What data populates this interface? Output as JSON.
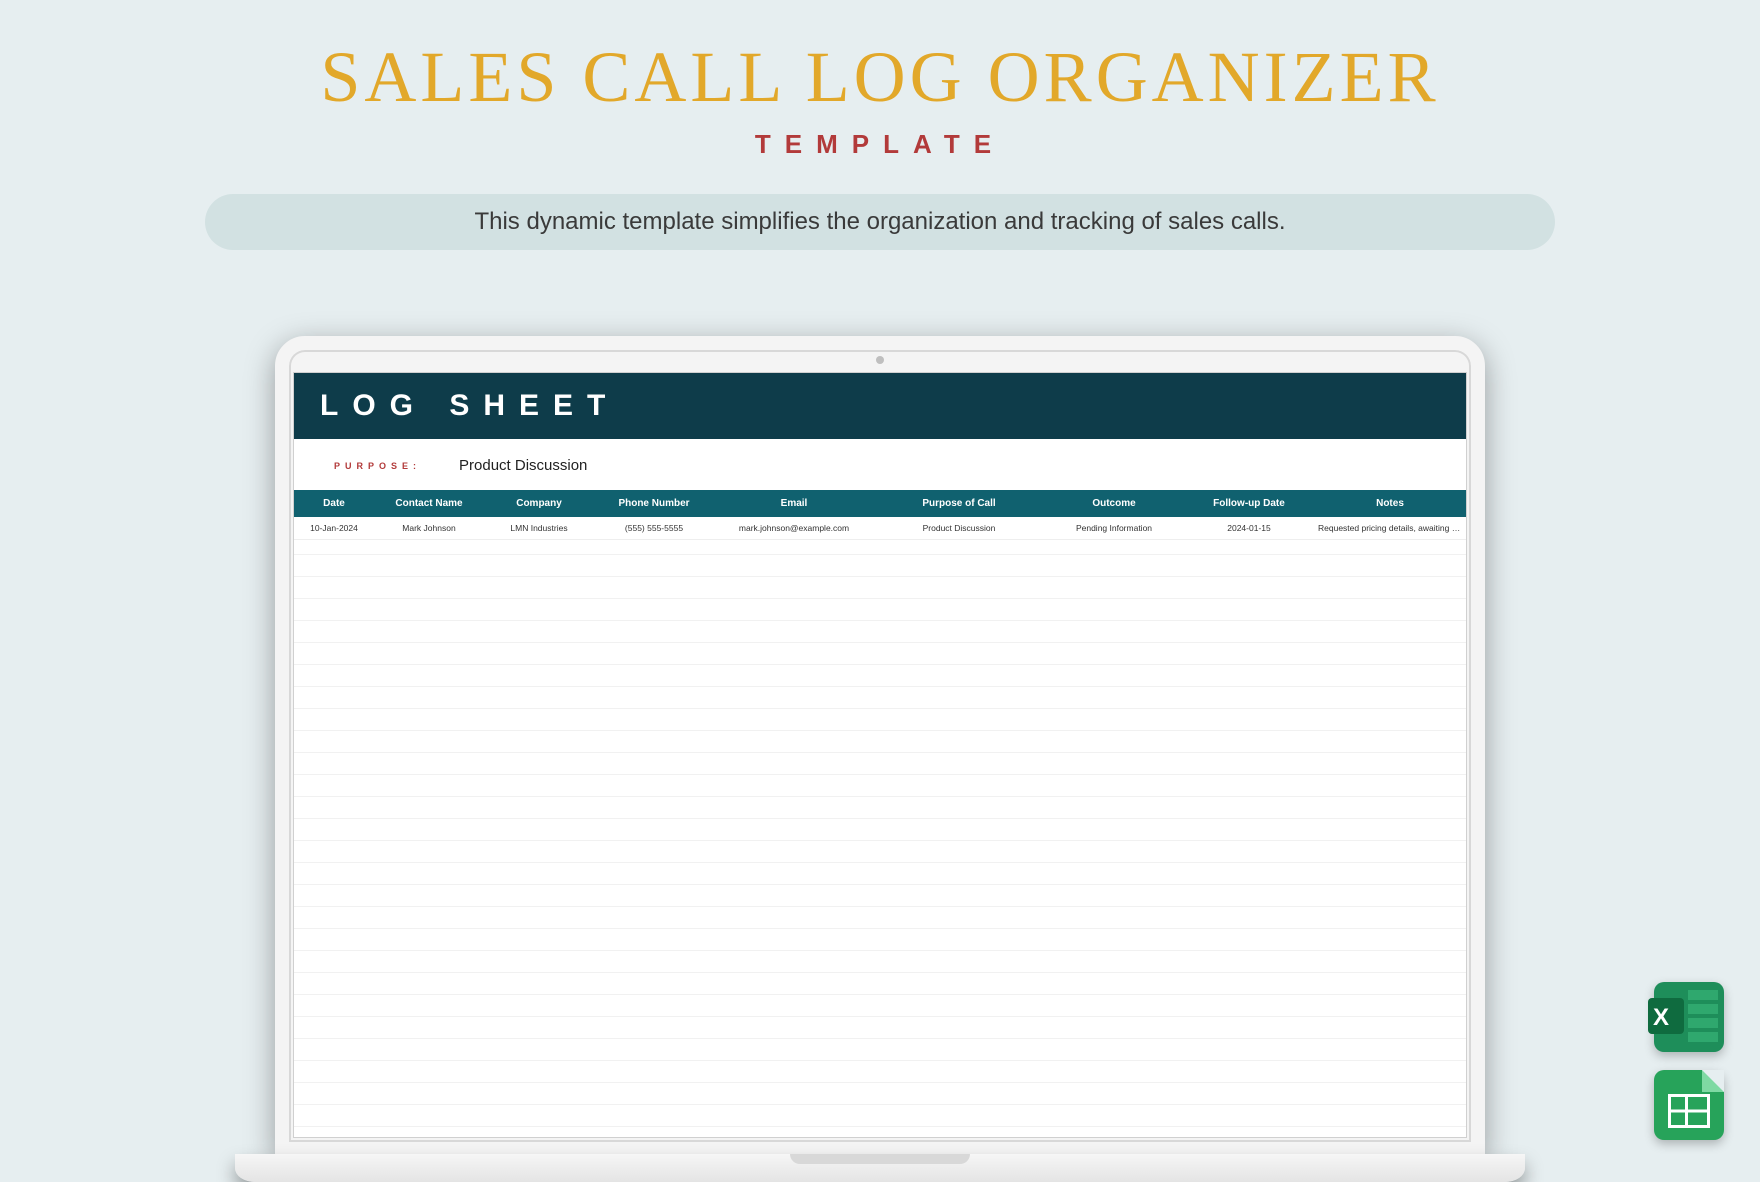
{
  "title": "SALES CALL LOG ORGANIZER",
  "subtitle": "TEMPLATE",
  "tagline": "This dynamic template simplifies the organization and tracking of sales calls.",
  "sheet": {
    "header": "LOG SHEET",
    "purpose_label": "PURPOSE:",
    "purpose_value": "Product Discussion",
    "columns": {
      "date": "Date",
      "contact": "Contact Name",
      "company": "Company",
      "phone": "Phone Number",
      "email": "Email",
      "purpose": "Purpose of Call",
      "outcome": "Outcome",
      "followup": "Follow-up Date",
      "notes": "Notes"
    },
    "rows": [
      {
        "date": "10-Jan-2024",
        "contact": "Mark Johnson",
        "company": "LMN Industries",
        "phone": "(555) 555-5555",
        "email": "mark.johnson@example.com",
        "purpose": "Product Discussion",
        "outcome": "Pending Information",
        "followup": "2024-01-15",
        "notes": "Requested pricing details, awaiting response."
      }
    ]
  },
  "icons": {
    "excel": "excel-icon",
    "sheets": "google-sheets-icon"
  }
}
